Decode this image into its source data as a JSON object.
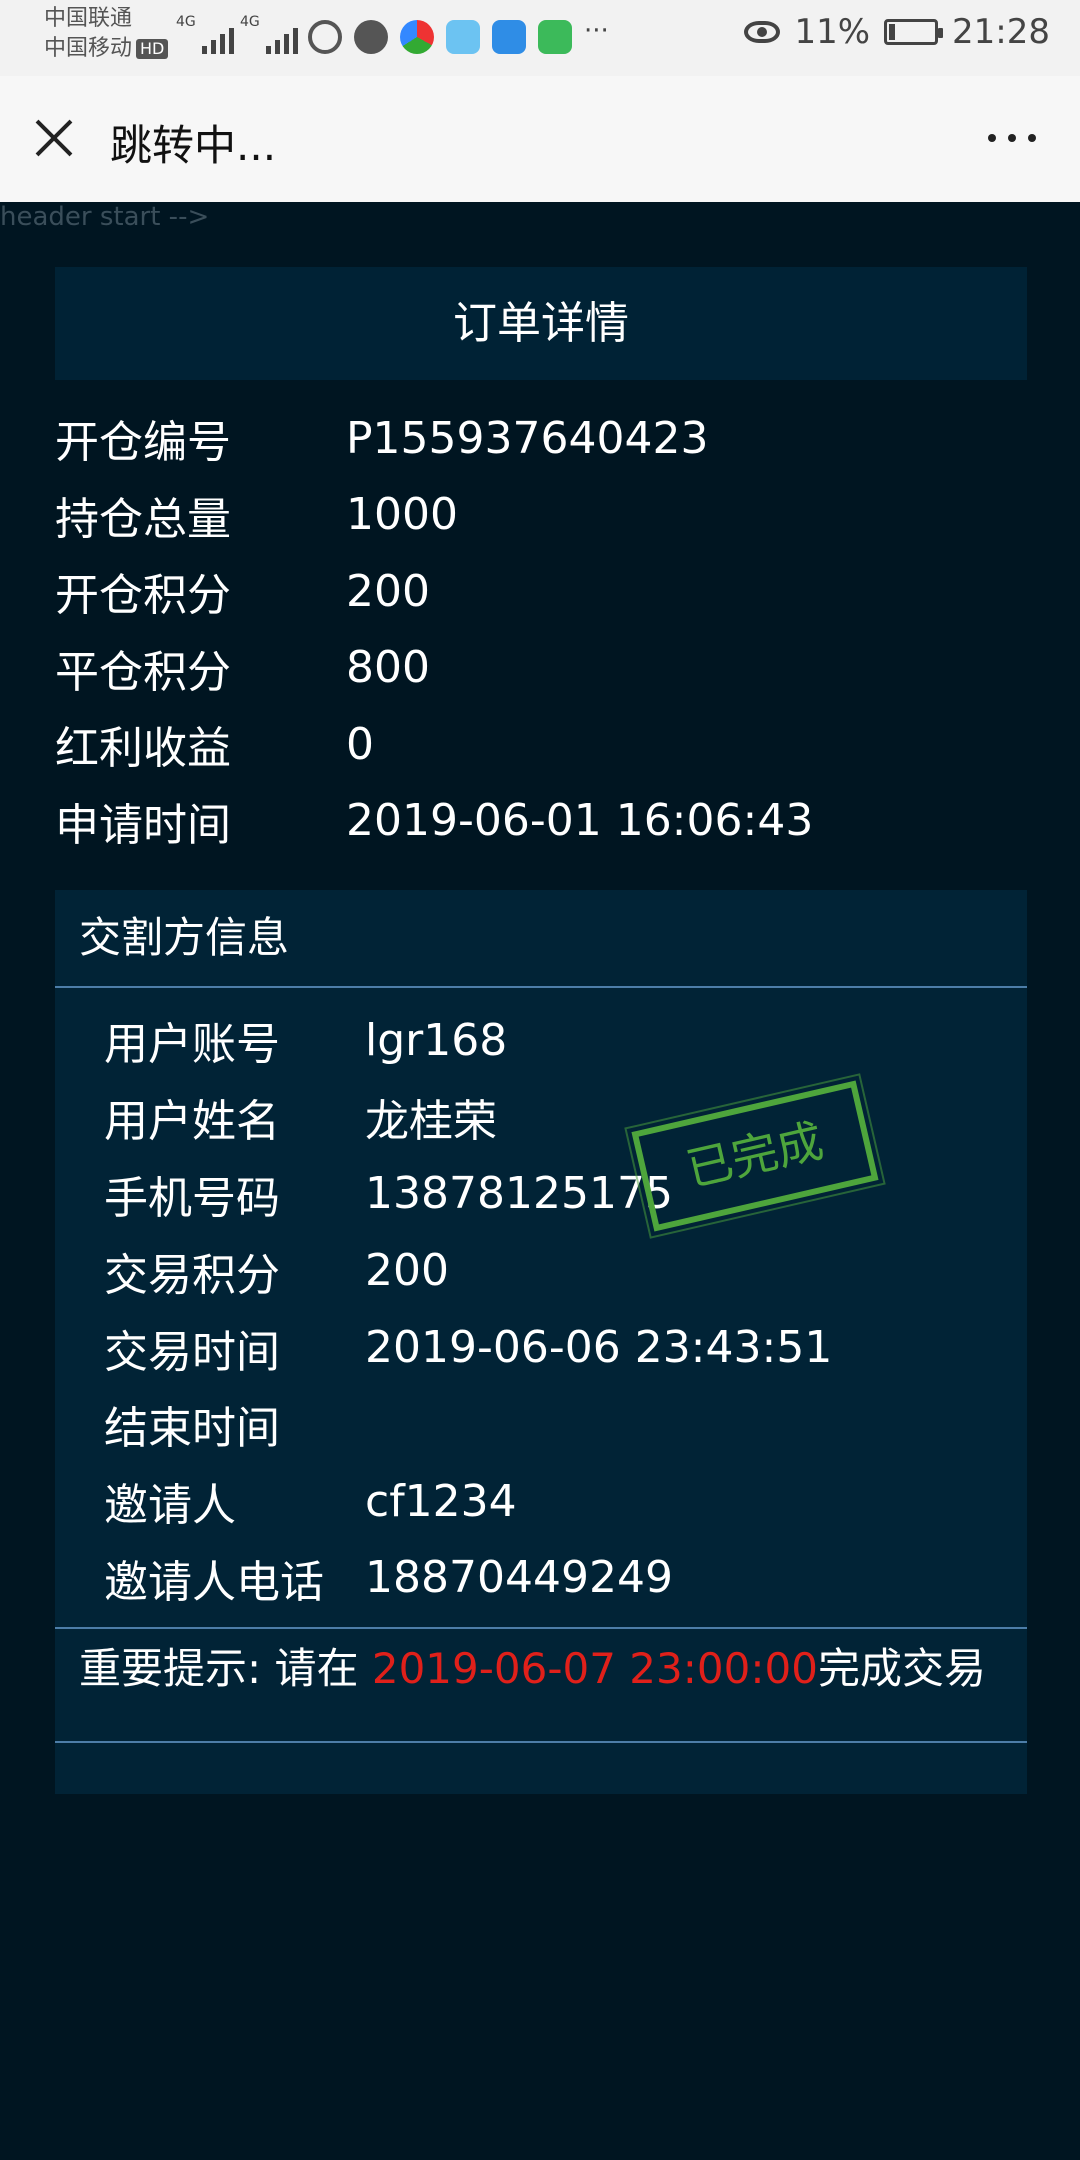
{
  "status_bar": {
    "carrier1": "中国联通",
    "carrier2": "中国移动",
    "hd": "HD",
    "net1": "4G",
    "net2": "4G",
    "more": "···",
    "battery": "11%",
    "time": "21:28"
  },
  "app_bar": {
    "title": "跳转中..."
  },
  "leak_text": "header start -->",
  "order": {
    "title": "订单详情",
    "rows": [
      {
        "label": "开仓编号",
        "value": "P155937640423"
      },
      {
        "label": "持仓总量",
        "value": "1000"
      },
      {
        "label": "开仓积分",
        "value": "200"
      },
      {
        "label": "平仓积分",
        "value": "800"
      },
      {
        "label": "红利收益",
        "value": "0"
      },
      {
        "label": "申请时间",
        "value": "2019-06-01 16:06:43"
      }
    ]
  },
  "counterparty": {
    "title": "交割方信息",
    "rows": [
      {
        "label": "用户账号",
        "value": "lgr168"
      },
      {
        "label": "用户姓名",
        "value": "龙桂荣"
      },
      {
        "label": "手机号码",
        "value": "13878125175"
      },
      {
        "label": "交易积分",
        "value": "200"
      },
      {
        "label": "交易时间",
        "value": "2019-06-06 23:43:51"
      },
      {
        "label": "结束时间",
        "value": ""
      },
      {
        "label": "邀请人",
        "value": "cf1234"
      },
      {
        "label": "邀请人电话",
        "value": "18870449249"
      }
    ],
    "stamp": "已完成"
  },
  "notice": {
    "prefix": "重要提示: 请在 ",
    "deadline": "2019-06-07 23:00:00",
    "suffix": "完成交易"
  },
  "colors": {
    "background": "#001521",
    "deadline": "#e0201a",
    "stamp": "#4ea53c",
    "divider": "#4d7da8"
  }
}
